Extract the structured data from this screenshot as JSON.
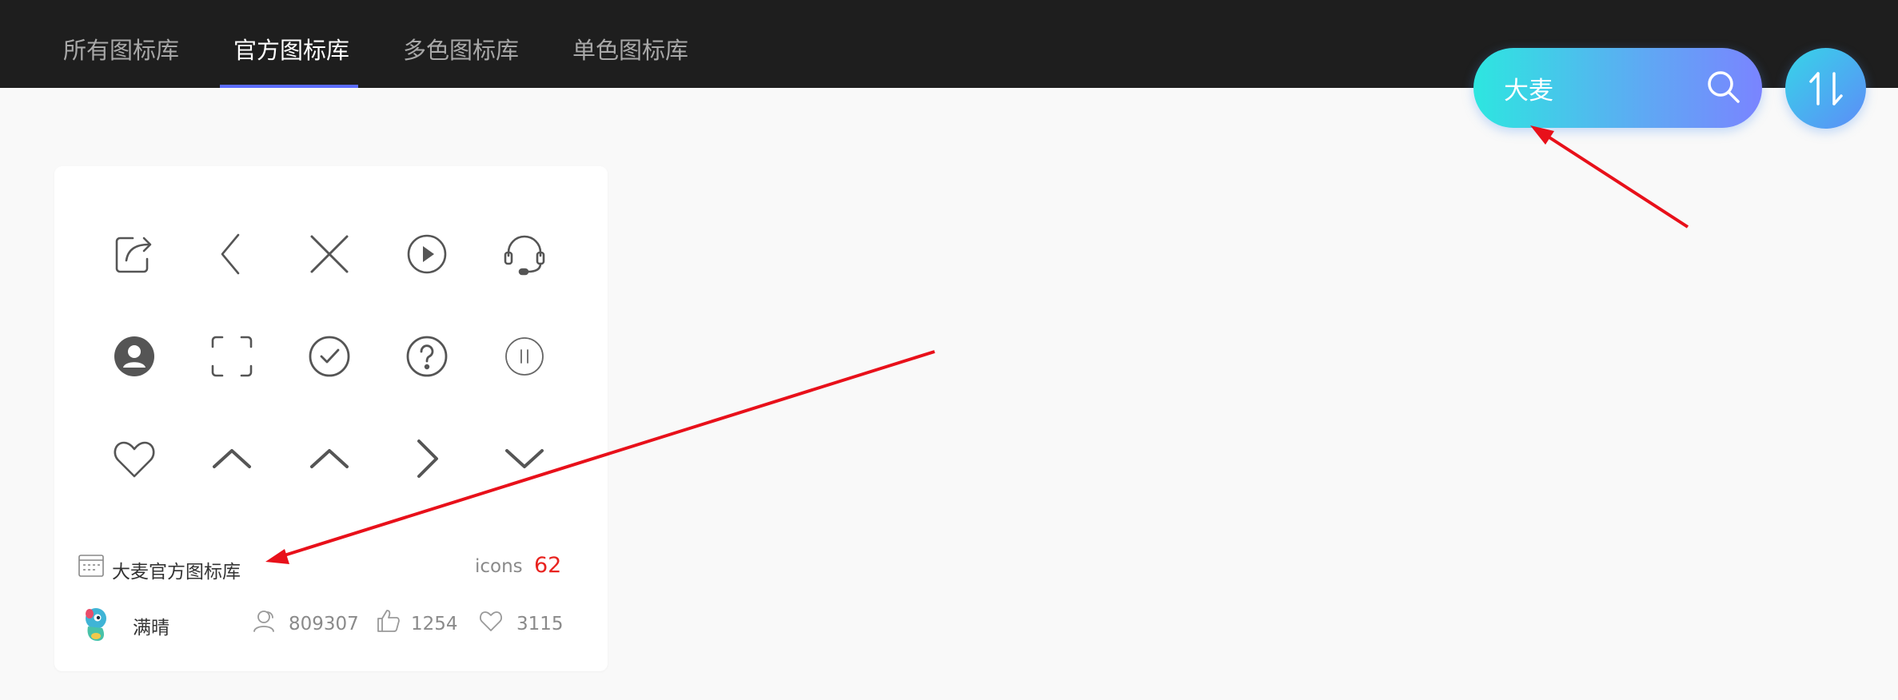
{
  "nav": {
    "tabs": [
      {
        "label": "所有图标库",
        "active": false
      },
      {
        "label": "官方图标库",
        "active": true
      },
      {
        "label": "多色图标库",
        "active": false
      },
      {
        "label": "单色图标库",
        "active": false
      }
    ]
  },
  "search": {
    "value": "大麦",
    "icon": "search-icon"
  },
  "sort": {
    "icon": "sort-icon"
  },
  "card": {
    "icons": [
      "share-icon",
      "chevron-left-icon",
      "close-icon",
      "play-circle-icon",
      "headset-icon",
      "user-circle-icon",
      "scan-frame-icon",
      "check-circle-icon",
      "question-circle-icon",
      "pause-circle-icon",
      "heart-icon",
      "chevron-up-icon",
      "chevron-up-icon",
      "chevron-right-icon",
      "chevron-down-icon"
    ],
    "library_name": "大麦官方图标库",
    "icons_label": "icons",
    "icons_count": "62",
    "author": "满晴",
    "stats": {
      "users": "809307",
      "likes": "1254",
      "favorites": "3115"
    }
  },
  "colors": {
    "topbar": "#1e1e1e",
    "accent": "#5b6cff",
    "count": "#e8231f",
    "annotation_arrow": "#e8101a"
  }
}
